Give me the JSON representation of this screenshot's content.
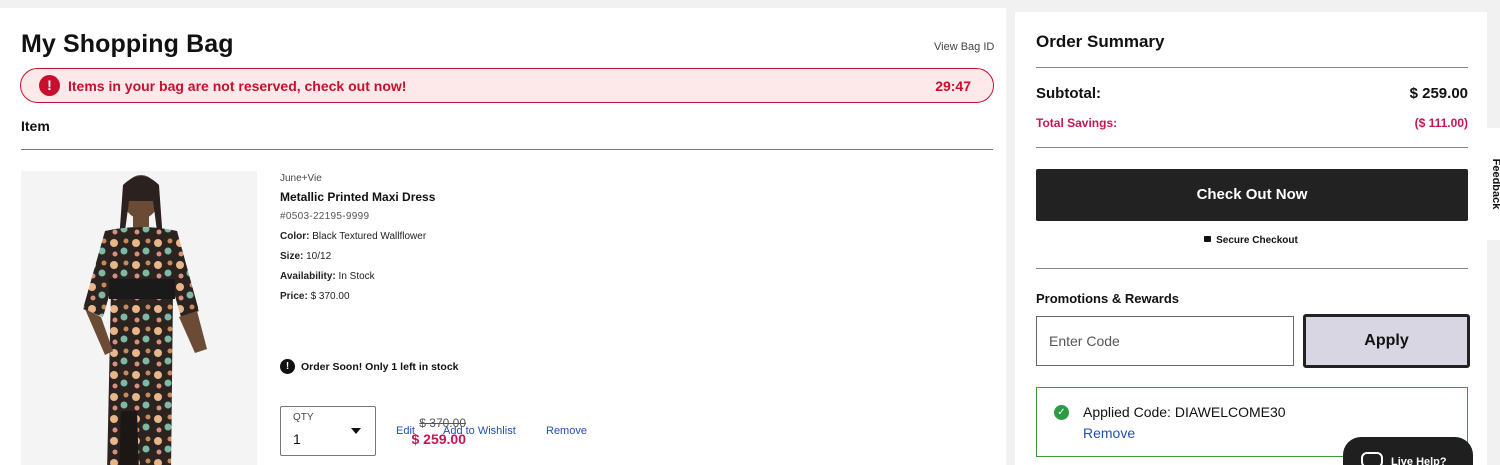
{
  "bag": {
    "title": "My Shopping Bag",
    "view_bag_id": "View Bag ID",
    "alert": {
      "text": "Items in your bag are not reserved, check out now!",
      "timer": "29:47",
      "icon": "!"
    },
    "item_header": "Item",
    "item": {
      "brand": "June+Vie",
      "name": "Metallic Printed Maxi Dress",
      "sku": "#0503-22195-9999",
      "color_label": "Color:",
      "color_value": "Black Textured Wallflower",
      "size_label": "Size:",
      "size_value": "10/12",
      "availability_label": "Availability:",
      "availability_value": "In Stock",
      "price_label": "Price:",
      "price_value": "$ 370.00",
      "stock_warning": "Order Soon! Only 1 left in stock",
      "warning_icon": "!",
      "qty_label": "QTY",
      "qty_value": "1",
      "edit_label": "Edit",
      "wishlist_label": "Add to Wishlist",
      "remove_label": "Remove",
      "original_price": "$ 370.00",
      "sale_price": "$ 259.00"
    }
  },
  "summary": {
    "title": "Order Summary",
    "subtotal_label": "Subtotal:",
    "subtotal_value": "$ 259.00",
    "savings_label": "Total Savings:",
    "savings_value": "($ 111.00)",
    "checkout_label": "Check Out Now",
    "secure_label": "Secure Checkout",
    "promos_title": "Promotions & Rewards",
    "code_placeholder": "Enter Code",
    "apply_label": "Apply",
    "applied_text": "Applied Code: DIAWELCOME30",
    "applied_remove": "Remove",
    "check_icon": "✓"
  },
  "feedback_label": "Feedback",
  "live_help_label": "Live Help?",
  "colors": {
    "alert_red": "#c8102e",
    "sale_pink": "#c41654",
    "link_blue": "#1f4fb5",
    "success_green": "#2d9b45"
  }
}
